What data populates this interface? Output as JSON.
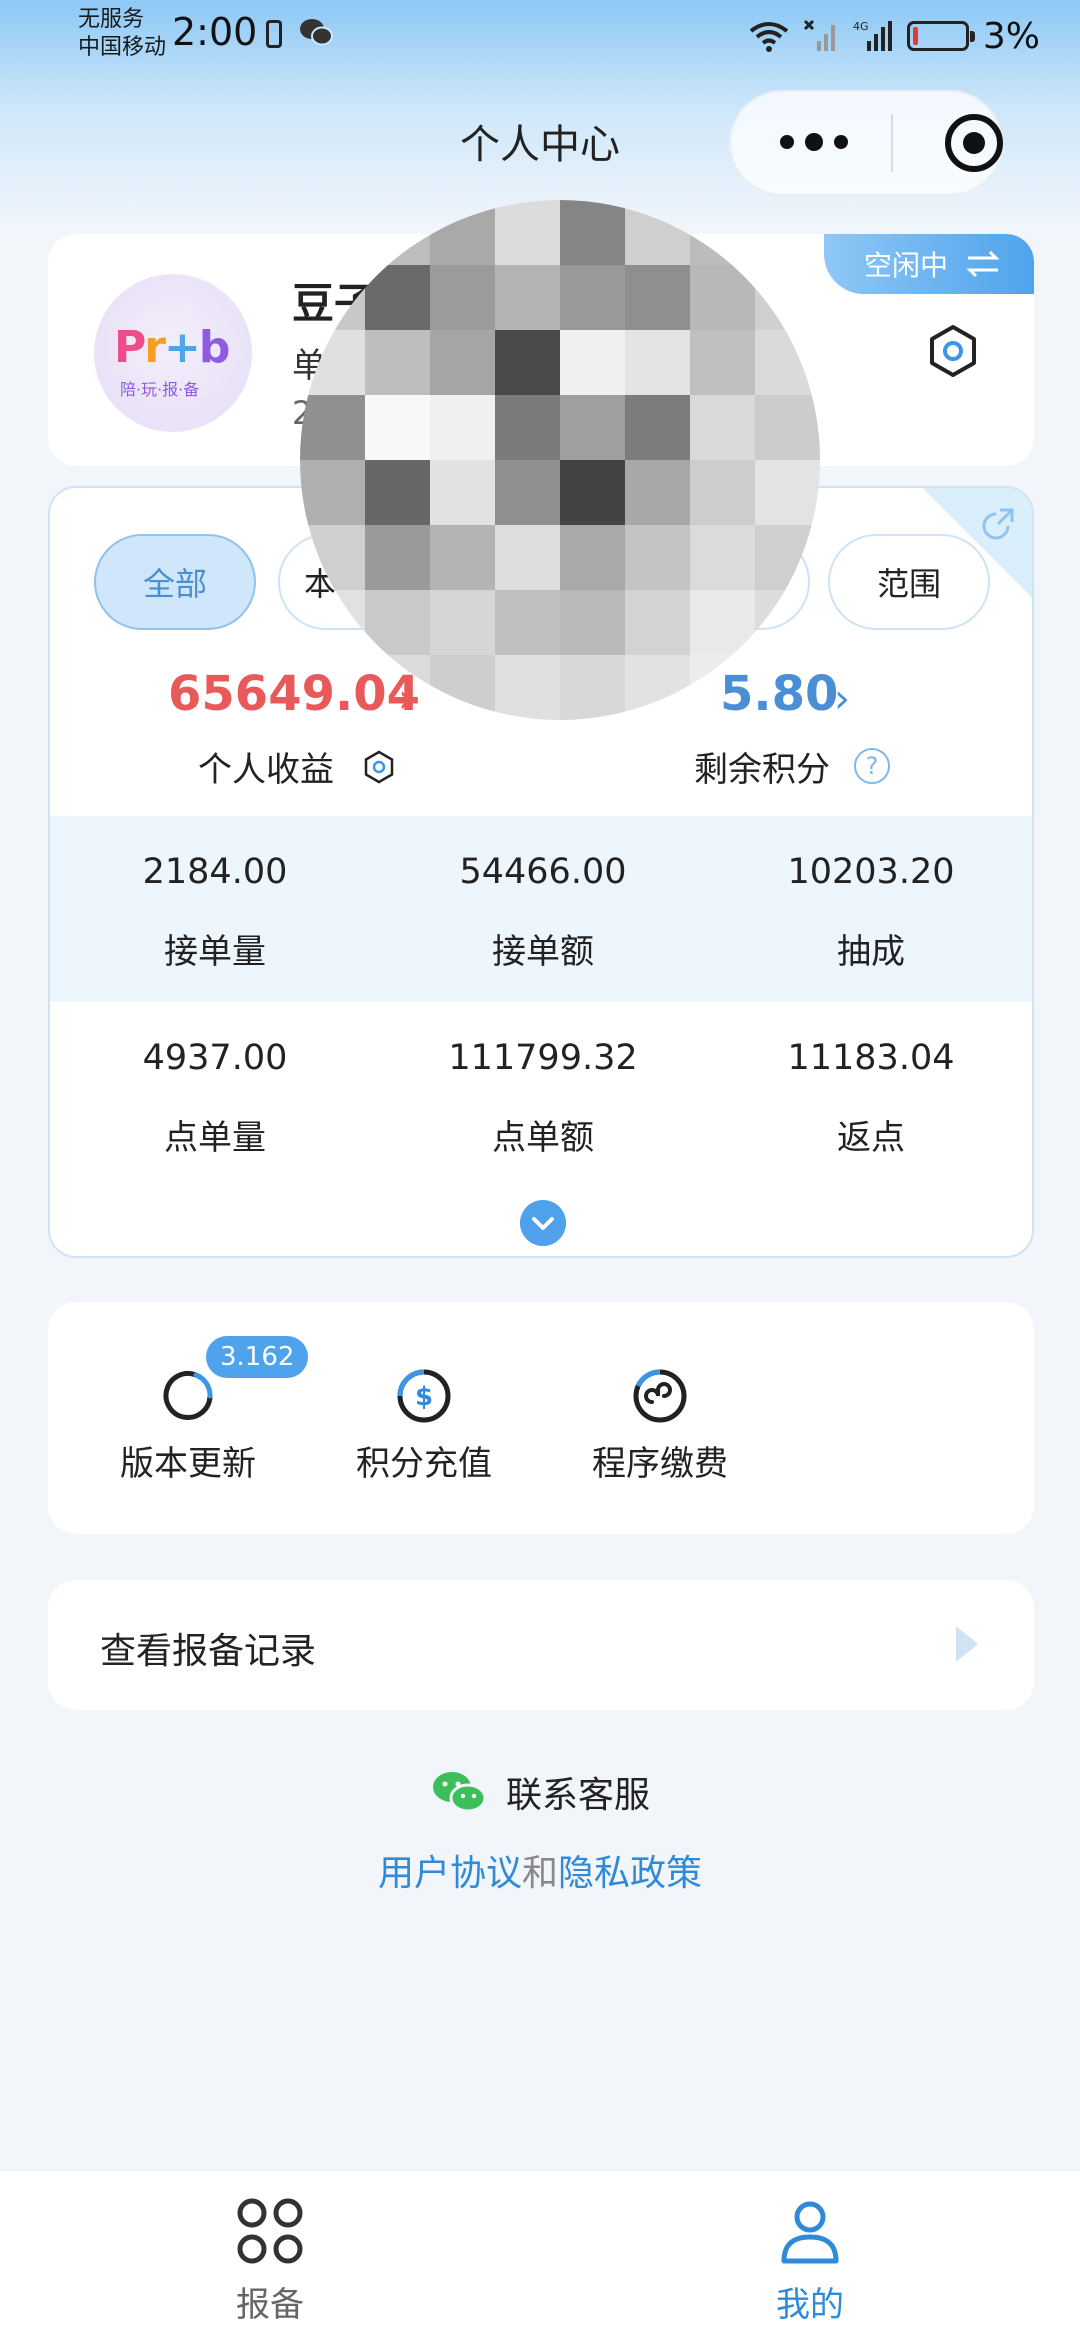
{
  "status_bar": {
    "carrier_line1": "无服务",
    "carrier_line2": "中国移动",
    "time": "2:00",
    "battery_percent": "3%"
  },
  "header": {
    "title": "个人中心"
  },
  "profile": {
    "name_visible": "豆子",
    "line2_visible": "单",
    "line3_visible": "2",
    "status_tag": "空闲中"
  },
  "filters": {
    "all": "全部",
    "today_partial": "本",
    "range": "范围"
  },
  "stats": {
    "income_value": "65649.04",
    "income_label": "个人收益",
    "points_value": "5.80",
    "points_label": "剩余积分",
    "help_mark": "?",
    "rows": [
      [
        {
          "value": "2184.00",
          "label": "接单量"
        },
        {
          "value": "54466.00",
          "label": "接单额"
        },
        {
          "value": "10203.20",
          "label": "抽成"
        }
      ],
      [
        {
          "value": "4937.00",
          "label": "点单量"
        },
        {
          "value": "111799.32",
          "label": "点单额"
        },
        {
          "value": "11183.04",
          "label": "返点"
        }
      ]
    ]
  },
  "actions": {
    "version_badge": "3.162",
    "items": [
      "版本更新",
      "积分充值",
      "程序缴费"
    ]
  },
  "record": {
    "label": "查看报备记录"
  },
  "footer": {
    "contact": "联系客服",
    "user_agreement": "用户协议",
    "and": "和",
    "privacy_policy": "隐私政策"
  },
  "tabbar": {
    "report": "报备",
    "mine": "我的"
  },
  "colors": {
    "accent": "#4fa3ec",
    "income": "#e85a5a",
    "points": "#4a8fd6",
    "link": "#2f8ad9"
  },
  "mosaic_shades": [
    "#d4d4d4",
    "#bdbdbd",
    "#a9a9a9",
    "#dcdcdc",
    "#858585",
    "#cfcfcf",
    "#bcbcbc",
    "#e6e6e6",
    "#c8c8c8",
    "#6a6a6a",
    "#9b9b9b",
    "#b3b3b3",
    "#999999",
    "#8f8f8f",
    "#b8b8b8",
    "#d0d0d0",
    "#e0e0e0",
    "#bebebe",
    "#a5a5a5",
    "#4a4a4a",
    "#f0f0f0",
    "#e4e4e4",
    "#c0c0c0",
    "#dadada",
    "#909090",
    "#f8f8f8",
    "#f0f0f0",
    "#7b7b7b",
    "#9f9f9f",
    "#7c7c7c",
    "#d9d9d9",
    "#cccccc",
    "#b0b0b0",
    "#676767",
    "#e2e2e2",
    "#8f8f8f",
    "#434343",
    "#a8a8a8",
    "#cdcdcd",
    "#e3e3e3",
    "#cfcfcf",
    "#9a9a9a",
    "#b4b4b4",
    "#dedede",
    "#a9a9a9",
    "#c4c4c4",
    "#dbdbdb",
    "#cfcfcf",
    "#e1e1e1",
    "#c9c9c9",
    "#d6d6d6",
    "#bfbfbf",
    "#b9b9b9",
    "#d3d3d3",
    "#e9e9e9",
    "#dcdcdc",
    "#eaeaea",
    "#dcdcdc",
    "#cecece",
    "#e0e0e0",
    "#d8d8d8",
    "#e2e2e2",
    "#ececec",
    "#e8e8e8"
  ]
}
